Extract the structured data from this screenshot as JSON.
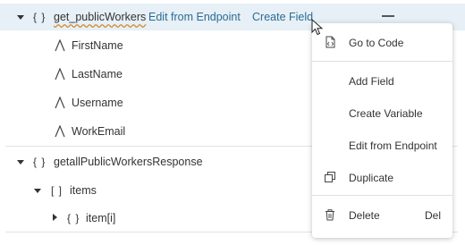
{
  "tree": {
    "root": {
      "braces": "{ }",
      "name": "get_publicWorkers",
      "action_edit": "Edit from Endpoint",
      "action_create": "Create Field"
    },
    "fields": [
      "FirstName",
      "LastName",
      "Username",
      "WorkEmail"
    ],
    "response": {
      "braces": "{ }",
      "name": "getallPublicWorkersResponse"
    },
    "items": {
      "brackets": "[ ]",
      "name": "items"
    },
    "item": {
      "braces": "{ }",
      "name": "item[i]"
    }
  },
  "context_menu": {
    "go_to_code": "Go to Code",
    "add_field": "Add Field",
    "create_variable": "Create Variable",
    "edit_from_endpoint": "Edit from Endpoint",
    "duplicate": "Duplicate",
    "delete": "Delete",
    "delete_shortcut": "Del"
  },
  "icons": {
    "field_type": "text-type-icon",
    "go_to_code": "code-file-icon",
    "duplicate": "duplicate-icon",
    "delete": "trash-icon",
    "collapse": "minus-icon"
  },
  "colors": {
    "selection_bg": "#e6f0f6",
    "link": "#2c6b94"
  }
}
